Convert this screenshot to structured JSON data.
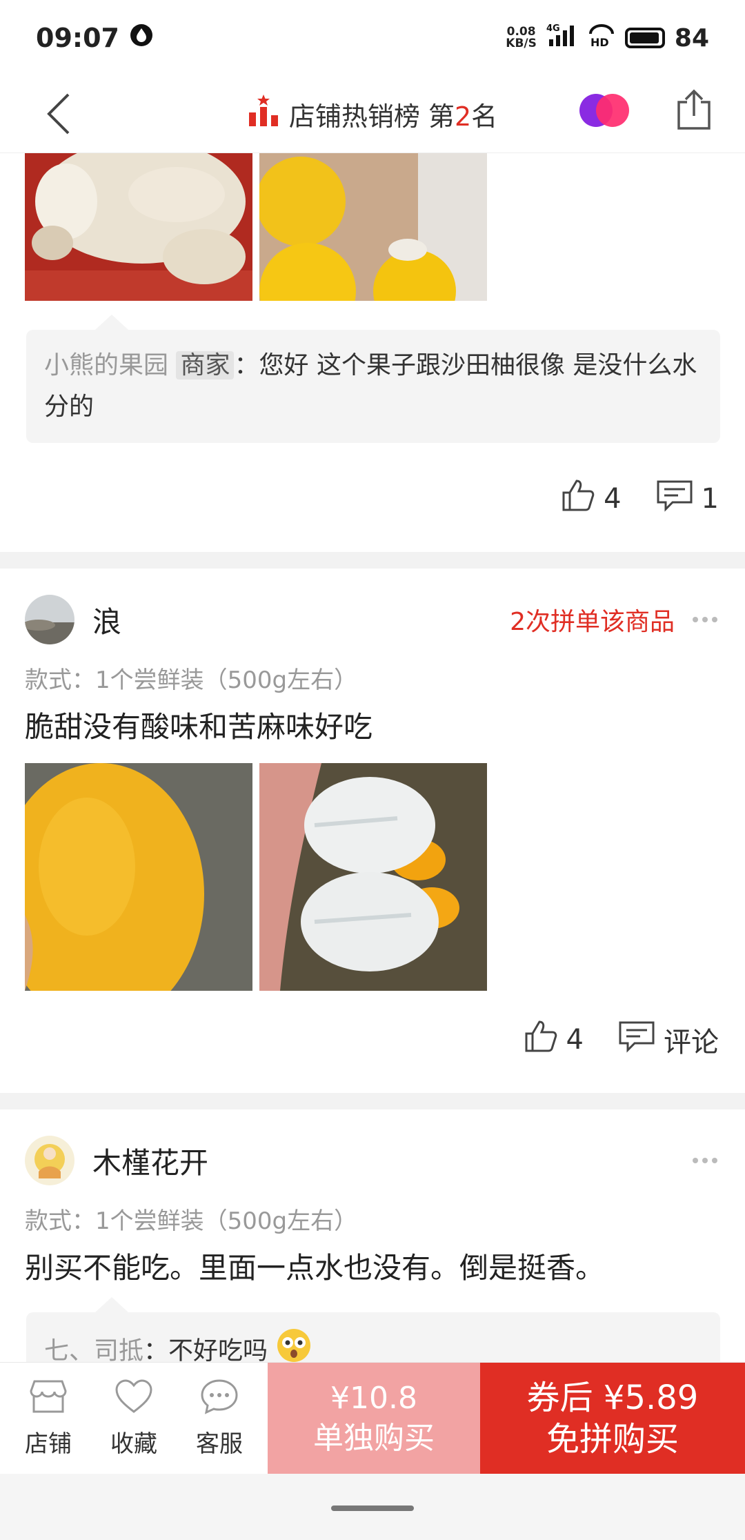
{
  "status_bar": {
    "time": "09:07",
    "net_speed_value": "0.08",
    "net_speed_unit": "KB/S",
    "network": "4G",
    "hd": "HD",
    "battery": "84"
  },
  "nav": {
    "title_prefix": "店铺热销榜 第",
    "rank": "2",
    "title_suffix": "名"
  },
  "reviews": [
    {
      "reply": {
        "name": "小熊的果园",
        "tag": "商家",
        "colon": "：",
        "text": "您好 这个果子跟沙田柚很像 是没什么水分的"
      },
      "likes": "4",
      "comments": "1"
    },
    {
      "name": "浪",
      "badge": "2次拼单该商品",
      "spec": "款式：1个尝鲜装（500g左右）",
      "text": "脆甜没有酸味和苦麻味好吃",
      "likes": "4",
      "comments": "评论"
    },
    {
      "name": "木槿花开",
      "spec": "款式：1个尝鲜装（500g左右）",
      "text": "别买不能吃。里面一点水也没有。倒是挺香。",
      "reply": {
        "name": "七、司抵",
        "colon": "：",
        "text": "不好吃吗"
      }
    }
  ],
  "bottom_bar": {
    "shop": "店铺",
    "favorite": "收藏",
    "service": "客服",
    "single_price": "¥10.8",
    "single_label": "单独购买",
    "group_price": "券后 ¥5.89",
    "group_label": "免拼购买"
  },
  "colors": {
    "accent": "#e02e24",
    "accent_light": "#f2a3a3"
  }
}
